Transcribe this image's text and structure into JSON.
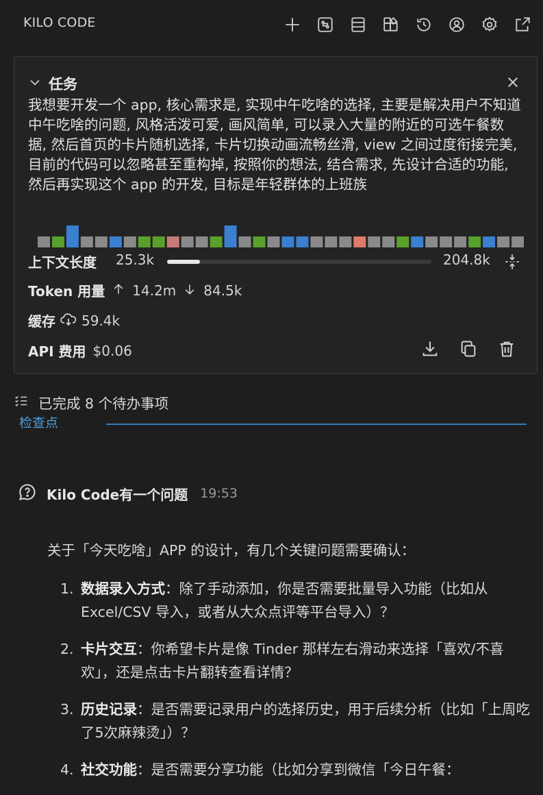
{
  "header": {
    "brand": "KILO CODE"
  },
  "header_icons": [
    "plus-icon",
    "mcp-icon",
    "stack-icon",
    "marketplace-icon",
    "history-icon",
    "account-icon",
    "gear-icon",
    "popout-icon"
  ],
  "task": {
    "title": "任务",
    "text": "我想要开发一个 app, 核心需求是, 实现中午吃啥的选择, 主要是解决用户不知道中午吃啥的问题, 风格活泼可爱, 画风简单, 可以录入大量的附近的可选午餐数据, 然后首页的卡片随机选择, 卡片切换动画流畅丝滑, view 之间过度衔接完美, 目前的代码可以忽略甚至重构掉, 按照你的想法, 结合需求, 先设计合适的功能, 然后再实现这个 app 的开发, 目标是年轻群体的上班族",
    "context_label": "上下文长度",
    "context_used": "25.3k",
    "context_max": "204.8k",
    "context_fraction": 0.124,
    "token_label": "Token 用量",
    "tokens_in": "14.2m",
    "tokens_out": "84.5k",
    "cache_label": "缓存",
    "cache_value": "59.4k",
    "api_label": "API 费用",
    "api_value": "$0.06"
  },
  "context_blocks": [
    "#8a8a8a",
    "#5aa02c",
    "#3a7fd0",
    "#8a8a8a",
    "#8a8a8a",
    "#3a7fd0",
    "#8a8a8a",
    "#5aa02c",
    "#5aa02c",
    "#c87a7a",
    "#8a8a8a",
    "#8a8a8a",
    "#5aa02c",
    "#3a7fd0",
    "#8a8a8a",
    "#5aa02c",
    "#8a8a8a",
    "#3a7fd0",
    "#3a7fd0",
    "#8a8a8a",
    "#8a8a8a",
    "#8a8a8a",
    "#e07a6a",
    "#8a8a8a",
    "#8a8a8a",
    "#5aa02c",
    "#3a7fd0",
    "#8a8a8a",
    "#8a8a8a",
    "#8a8a8a",
    "#5aa02c",
    "#3a7fd0",
    "#8a8a8a",
    "#8a8a8a"
  ],
  "todo": {
    "text": "已完成 8 个待办事项"
  },
  "checkpoint": {
    "label": "检查点"
  },
  "message": {
    "author": "Kilo Code有一个问题",
    "time": "19:53",
    "intro": "关于「今天吃啥」APP 的设计，有几个关键问题需要确认：",
    "questions": [
      {
        "num": "1.",
        "title": "数据录入方式",
        "body": "：除了手动添加，你是否需要批量导入功能（比如从 Excel/CSV 导入，或者从大众点评等平台导入）？"
      },
      {
        "num": "2.",
        "title": "卡片交互",
        "body": "：你希望卡片是像 Tinder 那样左右滑动来选择「喜欢/不喜欢」，还是点击卡片翻转查看详情？"
      },
      {
        "num": "3.",
        "title": "历史记录",
        "body": "：是否需要记录用户的选择历史，用于后续分析（比如「上周吃了5次麻辣烫」）？"
      },
      {
        "num": "4.",
        "title": "社交功能",
        "body": "：是否需要分享功能（比如分享到微信「今日午餐："
      }
    ]
  }
}
